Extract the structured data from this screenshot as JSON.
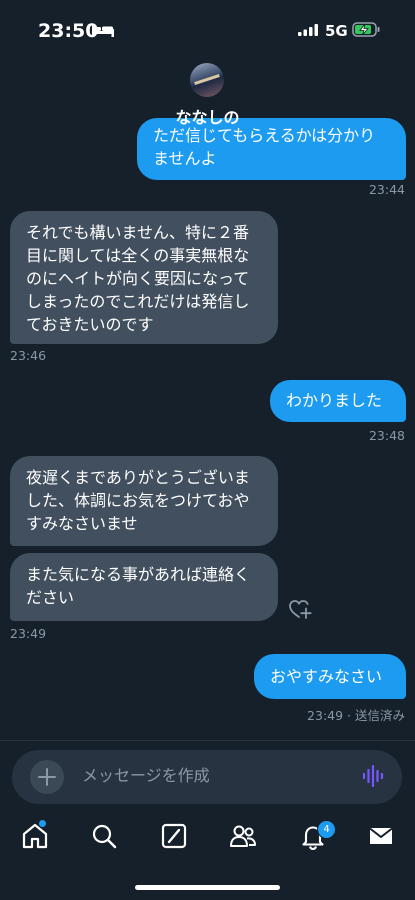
{
  "status_bar": {
    "time": "23:50",
    "network": "5G"
  },
  "header": {
    "contact_name": "ななしの"
  },
  "messages": [
    {
      "dir": "out",
      "lines": [
        "ただ信じてもらえるかは分かり",
        "ませんよ"
      ]
    },
    {
      "time": "23:44"
    },
    {
      "dir": "in",
      "lines": [
        "それでも構いません、特に２番",
        "目に関しては全くの事実無根な",
        "のにヘイトが向く要因になって",
        "しまったのでこれだけは発信し",
        "ておきたいのです"
      ]
    },
    {
      "time": "23:46"
    },
    {
      "dir": "out",
      "lines": [
        "わかりました"
      ]
    },
    {
      "time": "23:48"
    },
    {
      "dir": "in",
      "lines": [
        "夜遅くまでありがとうございま",
        "した、体調にお気をつけておや",
        "すみなさいませ"
      ]
    },
    {
      "dir": "in",
      "lines": [
        "また気になる事があれば連絡く",
        "ださい"
      ]
    },
    {
      "time": "23:49"
    },
    {
      "dir": "out",
      "lines": [
        "おやすみなさい"
      ]
    },
    {
      "time": "23:49 · 送信済み"
    }
  ],
  "composer": {
    "placeholder": "メッセージを作成"
  },
  "tabbar": {
    "notification_count": "4"
  },
  "colors": {
    "background": "#15202b",
    "outgoing_bubble": "#1d9bf0",
    "incoming_bubble": "#414f5e",
    "meta_text": "#8b98a5"
  }
}
